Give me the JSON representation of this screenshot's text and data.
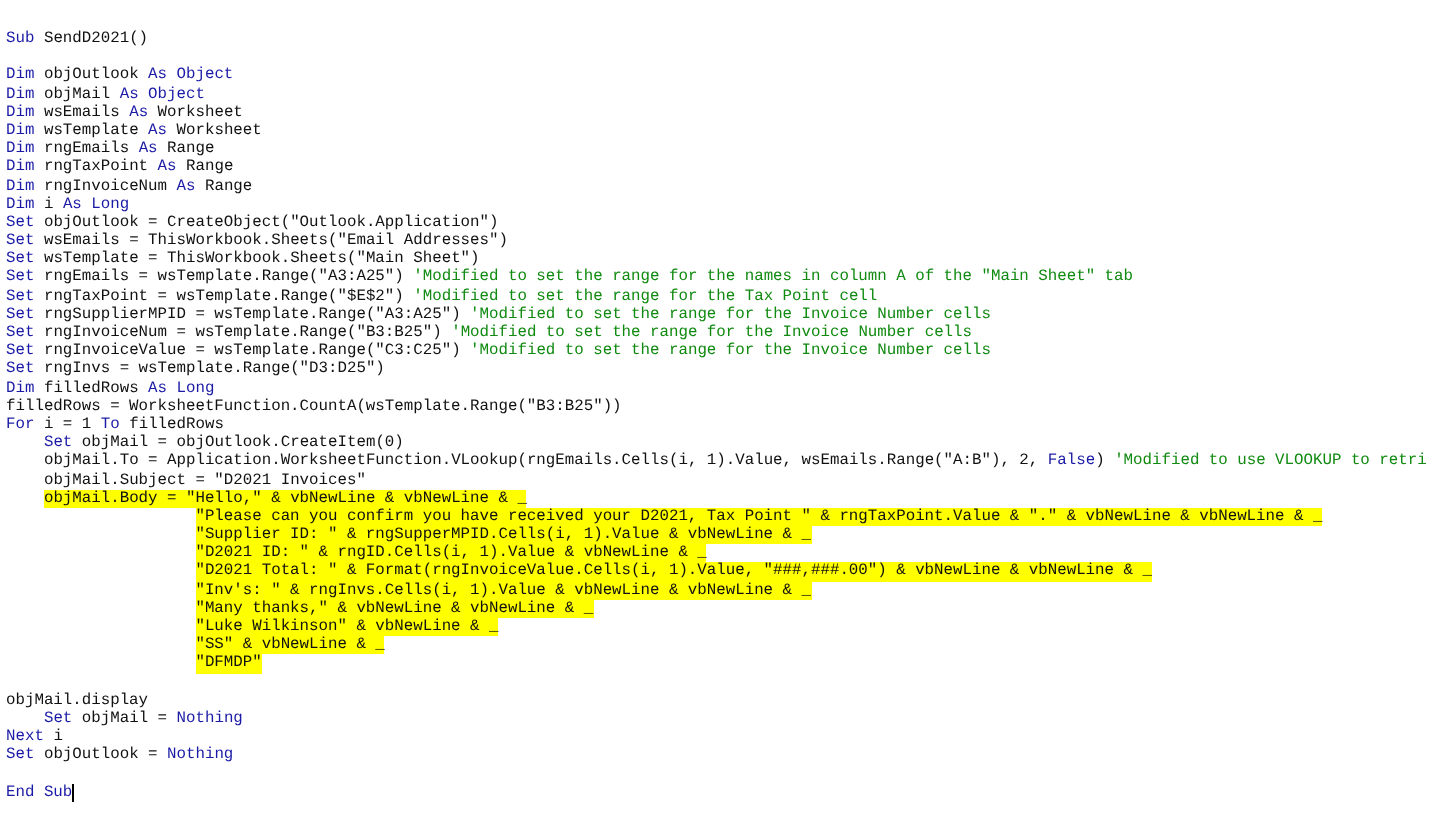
{
  "editor": {
    "lines": [
      {
        "kind": "code",
        "highlighted": false,
        "tokens": [
          {
            "kind": "keyword",
            "text": "Sub"
          },
          {
            "kind": "plain",
            "text": " SendD2021()"
          }
        ]
      },
      {
        "kind": "blank"
      },
      {
        "kind": "code",
        "highlighted": false,
        "tokens": [
          {
            "kind": "keyword",
            "text": "Dim"
          },
          {
            "kind": "plain",
            "text": " objOutlook "
          },
          {
            "kind": "keyword",
            "text": "As Object"
          }
        ]
      },
      {
        "kind": "code",
        "highlighted": false,
        "tokens": [
          {
            "kind": "keyword",
            "text": "Dim"
          },
          {
            "kind": "plain",
            "text": " objMail "
          },
          {
            "kind": "keyword",
            "text": "As Object"
          }
        ]
      },
      {
        "kind": "code",
        "highlighted": false,
        "tokens": [
          {
            "kind": "keyword",
            "text": "Dim"
          },
          {
            "kind": "plain",
            "text": " wsEmails "
          },
          {
            "kind": "keyword",
            "text": "As"
          },
          {
            "kind": "plain",
            "text": " Worksheet"
          }
        ]
      },
      {
        "kind": "code",
        "highlighted": false,
        "tokens": [
          {
            "kind": "keyword",
            "text": "Dim"
          },
          {
            "kind": "plain",
            "text": " wsTemplate "
          },
          {
            "kind": "keyword",
            "text": "As"
          },
          {
            "kind": "plain",
            "text": " Worksheet"
          }
        ]
      },
      {
        "kind": "code",
        "highlighted": false,
        "tokens": [
          {
            "kind": "keyword",
            "text": "Dim"
          },
          {
            "kind": "plain",
            "text": " rngEmails "
          },
          {
            "kind": "keyword",
            "text": "As"
          },
          {
            "kind": "plain",
            "text": " Range"
          }
        ]
      },
      {
        "kind": "code",
        "highlighted": false,
        "tokens": [
          {
            "kind": "keyword",
            "text": "Dim"
          },
          {
            "kind": "plain",
            "text": " rngTaxPoint "
          },
          {
            "kind": "keyword",
            "text": "As"
          },
          {
            "kind": "plain",
            "text": " Range"
          }
        ]
      },
      {
        "kind": "code",
        "highlighted": false,
        "tokens": [
          {
            "kind": "keyword",
            "text": "Dim"
          },
          {
            "kind": "plain",
            "text": " rngInvoiceNum "
          },
          {
            "kind": "keyword",
            "text": "As"
          },
          {
            "kind": "plain",
            "text": " Range"
          }
        ]
      },
      {
        "kind": "code",
        "highlighted": false,
        "tokens": [
          {
            "kind": "keyword",
            "text": "Dim"
          },
          {
            "kind": "plain",
            "text": " i "
          },
          {
            "kind": "keyword",
            "text": "As Long"
          }
        ]
      },
      {
        "kind": "code",
        "highlighted": false,
        "tokens": [
          {
            "kind": "keyword",
            "text": "Set"
          },
          {
            "kind": "plain",
            "text": " objOutlook = CreateObject(\"Outlook.Application\")"
          }
        ]
      },
      {
        "kind": "code",
        "highlighted": false,
        "tokens": [
          {
            "kind": "keyword",
            "text": "Set"
          },
          {
            "kind": "plain",
            "text": " wsEmails = ThisWorkbook.Sheets(\"Email Addresses\")"
          }
        ]
      },
      {
        "kind": "code",
        "highlighted": false,
        "tokens": [
          {
            "kind": "keyword",
            "text": "Set"
          },
          {
            "kind": "plain",
            "text": " wsTemplate = ThisWorkbook.Sheets(\"Main Sheet\")"
          }
        ]
      },
      {
        "kind": "code",
        "highlighted": false,
        "tokens": [
          {
            "kind": "keyword",
            "text": "Set"
          },
          {
            "kind": "plain",
            "text": " rngEmails = wsTemplate.Range(\"A3:A25\") "
          },
          {
            "kind": "comment",
            "text": "'Modified to set the range for the names in column A of the \"Main Sheet\" tab"
          }
        ]
      },
      {
        "kind": "code",
        "highlighted": false,
        "tokens": [
          {
            "kind": "keyword",
            "text": "Set"
          },
          {
            "kind": "plain",
            "text": " rngTaxPoint = wsTemplate.Range(\"$E$2\") "
          },
          {
            "kind": "comment",
            "text": "'Modified to set the range for the Tax Point cell"
          }
        ]
      },
      {
        "kind": "code",
        "highlighted": false,
        "tokens": [
          {
            "kind": "keyword",
            "text": "Set"
          },
          {
            "kind": "plain",
            "text": " rngSupplierMPID = wsTemplate.Range(\"A3:A25\") "
          },
          {
            "kind": "comment",
            "text": "'Modified to set the range for the Invoice Number cells"
          }
        ]
      },
      {
        "kind": "code",
        "highlighted": false,
        "tokens": [
          {
            "kind": "keyword",
            "text": "Set"
          },
          {
            "kind": "plain",
            "text": " rngInvoiceNum = wsTemplate.Range(\"B3:B25\") "
          },
          {
            "kind": "comment",
            "text": "'Modified to set the range for the Invoice Number cells"
          }
        ]
      },
      {
        "kind": "code",
        "highlighted": false,
        "tokens": [
          {
            "kind": "keyword",
            "text": "Set"
          },
          {
            "kind": "plain",
            "text": " rngInvoiceValue = wsTemplate.Range(\"C3:C25\") "
          },
          {
            "kind": "comment",
            "text": "'Modified to set the range for the Invoice Number cells"
          }
        ]
      },
      {
        "kind": "code",
        "highlighted": false,
        "tokens": [
          {
            "kind": "keyword",
            "text": "Set"
          },
          {
            "kind": "plain",
            "text": " rngInvs = wsTemplate.Range(\"D3:D25\")"
          }
        ]
      },
      {
        "kind": "code",
        "highlighted": false,
        "tokens": [
          {
            "kind": "keyword",
            "text": "Dim"
          },
          {
            "kind": "plain",
            "text": " filledRows "
          },
          {
            "kind": "keyword",
            "text": "As Long"
          }
        ]
      },
      {
        "kind": "code",
        "highlighted": false,
        "tokens": [
          {
            "kind": "plain",
            "text": "filledRows = WorksheetFunction.CountA(wsTemplate.Range(\"B3:B25\"))"
          }
        ]
      },
      {
        "kind": "code",
        "highlighted": false,
        "tokens": [
          {
            "kind": "keyword",
            "text": "For"
          },
          {
            "kind": "plain",
            "text": " i = 1 "
          },
          {
            "kind": "keyword",
            "text": "To"
          },
          {
            "kind": "plain",
            "text": " filledRows"
          }
        ]
      },
      {
        "kind": "code",
        "highlighted": false,
        "tokens": [
          {
            "kind": "keyword",
            "text": "    Set"
          },
          {
            "kind": "plain",
            "text": " objMail = objOutlook.CreateItem(0)"
          }
        ]
      },
      {
        "kind": "code",
        "highlighted": false,
        "tokens": [
          {
            "kind": "plain",
            "text": "    objMail.To = Application.WorksheetFunction.VLookup(rngEmails.Cells(i, 1).Value, wsEmails.Range(\"A:B\"), 2, "
          },
          {
            "kind": "keyword",
            "text": "False"
          },
          {
            "kind": "plain",
            "text": ") "
          },
          {
            "kind": "comment",
            "text": "'Modified to use VLOOKUP to retri"
          }
        ]
      },
      {
        "kind": "code",
        "highlighted": false,
        "tokens": [
          {
            "kind": "plain",
            "text": "    objMail.Subject = \"D2021 Invoices\""
          }
        ]
      },
      {
        "kind": "code",
        "highlighted": true,
        "tokens": [
          {
            "kind": "plain",
            "text": "    objMail.Body = \"Hello,\" & vbNewLine & vbNewLine & _"
          }
        ]
      },
      {
        "kind": "code",
        "highlighted": true,
        "tokens": [
          {
            "kind": "plain",
            "text": "                    \"Please can you confirm you have received your D2021, Tax Point \" & rngTaxPoint.Value & \".\" & vbNewLine & vbNewLine & _"
          }
        ]
      },
      {
        "kind": "code",
        "highlighted": true,
        "tokens": [
          {
            "kind": "plain",
            "text": "                    \"Supplier ID: \" & rngSupperMPID.Cells(i, 1).Value & vbNewLine & _"
          }
        ]
      },
      {
        "kind": "code",
        "highlighted": true,
        "tokens": [
          {
            "kind": "plain",
            "text": "                    \"D2021 ID: \" & rngID.Cells(i, 1).Value & vbNewLine & _"
          }
        ]
      },
      {
        "kind": "code",
        "highlighted": true,
        "tokens": [
          {
            "kind": "plain",
            "text": "                    \"D2021 Total: \" & Format(rngInvoiceValue.Cells(i, 1).Value, \"###,###.00\") & vbNewLine & vbNewLine & _"
          }
        ]
      },
      {
        "kind": "code",
        "highlighted": true,
        "tokens": [
          {
            "kind": "plain",
            "text": "                    \"Inv's: \" & rngInvs.Cells(i, 1).Value & vbNewLine & vbNewLine & _"
          }
        ]
      },
      {
        "kind": "code",
        "highlighted": true,
        "tokens": [
          {
            "kind": "plain",
            "text": "                    \"Many thanks,\" & vbNewLine & vbNewLine & _"
          }
        ]
      },
      {
        "kind": "code",
        "highlighted": true,
        "tokens": [
          {
            "kind": "plain",
            "text": "                    \"Luke Wilkinson\" & vbNewLine & _"
          }
        ]
      },
      {
        "kind": "code",
        "highlighted": true,
        "tokens": [
          {
            "kind": "plain",
            "text": "                    \"SS\" & vbNewLine & _"
          }
        ]
      },
      {
        "kind": "code",
        "highlighted": true,
        "tokens": [
          {
            "kind": "plain",
            "text": "                    \"DFMDP\""
          }
        ]
      },
      {
        "kind": "blank"
      },
      {
        "kind": "code",
        "highlighted": false,
        "tokens": [
          {
            "kind": "plain",
            "text": "objMail.display"
          }
        ]
      },
      {
        "kind": "code",
        "highlighted": false,
        "tokens": [
          {
            "kind": "keyword",
            "text": "    Set"
          },
          {
            "kind": "plain",
            "text": " objMail = "
          },
          {
            "kind": "keyword",
            "text": "Nothing"
          }
        ]
      },
      {
        "kind": "code",
        "highlighted": false,
        "tokens": [
          {
            "kind": "keyword",
            "text": "Next"
          },
          {
            "kind": "plain",
            "text": " i"
          }
        ]
      },
      {
        "kind": "code",
        "highlighted": false,
        "tokens": [
          {
            "kind": "keyword",
            "text": "Set"
          },
          {
            "kind": "plain",
            "text": " objOutlook = "
          },
          {
            "kind": "keyword",
            "text": "Nothing"
          }
        ]
      },
      {
        "kind": "blank"
      },
      {
        "kind": "code",
        "highlighted": false,
        "caret": true,
        "tokens": [
          {
            "kind": "keyword",
            "text": "End Sub"
          }
        ]
      }
    ]
  }
}
